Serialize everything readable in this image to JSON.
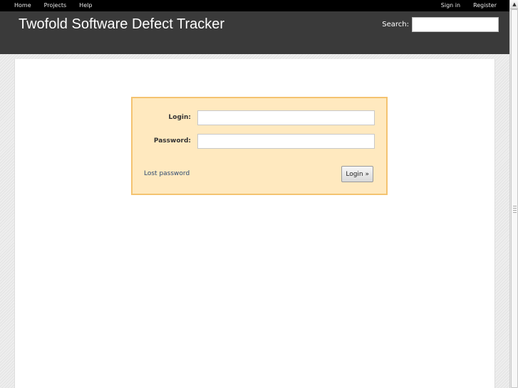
{
  "top_menu": {
    "left": [
      "Home",
      "Projects",
      "Help"
    ],
    "right": [
      "Sign in",
      "Register"
    ]
  },
  "header": {
    "title": "Twofold Software Defect Tracker",
    "search_label": "Search:",
    "search_value": ""
  },
  "login_form": {
    "login_label": "Login:",
    "login_value": "",
    "password_label": "Password:",
    "password_value": "",
    "lost_password": "Lost password",
    "submit_label": "Login »"
  },
  "colors": {
    "top_menu_bg": "#000000",
    "header_bg": "#3a3a3a",
    "login_box_bg": "#ffe9bf",
    "login_box_border": "#f4c370"
  },
  "icons": {
    "scroll_up": "up-arrow-icon"
  }
}
